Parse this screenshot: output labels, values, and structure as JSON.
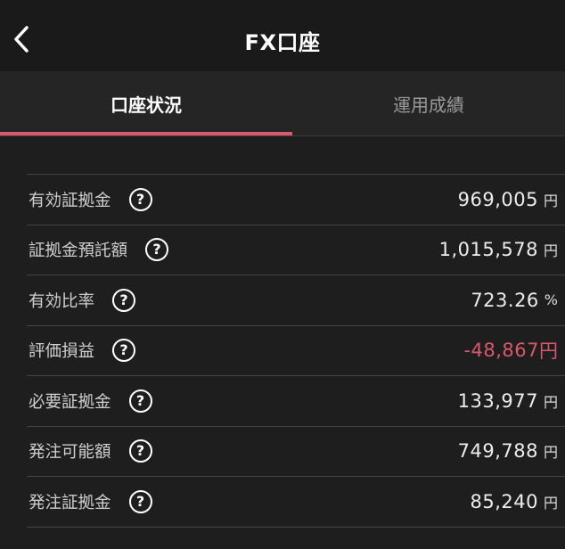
{
  "header": {
    "title": "FX口座"
  },
  "tabs": [
    {
      "label": "口座状況"
    },
    {
      "label": "運用成績"
    }
  ],
  "rows": [
    {
      "label": "有効証拠金",
      "value": "969,005",
      "unit": "円"
    },
    {
      "label": "証拠金預託額",
      "value": "1,015,578",
      "unit": "円"
    },
    {
      "label": "有効比率",
      "value": "723.26",
      "unit": "%"
    },
    {
      "label": "評価損益",
      "value": "-48,867",
      "unit": "円"
    },
    {
      "label": "必要証拠金",
      "value": "133,977",
      "unit": "円"
    },
    {
      "label": "発注可能額",
      "value": "749,788",
      "unit": "円"
    },
    {
      "label": "発注証拠金",
      "value": "85,240",
      "unit": "円"
    }
  ],
  "colors": {
    "accent": "#d9596a",
    "background": "#1e1e1e"
  },
  "icons": {
    "back": "chevron-left-icon",
    "help": "question-circle-icon",
    "help_glyph": "?"
  }
}
